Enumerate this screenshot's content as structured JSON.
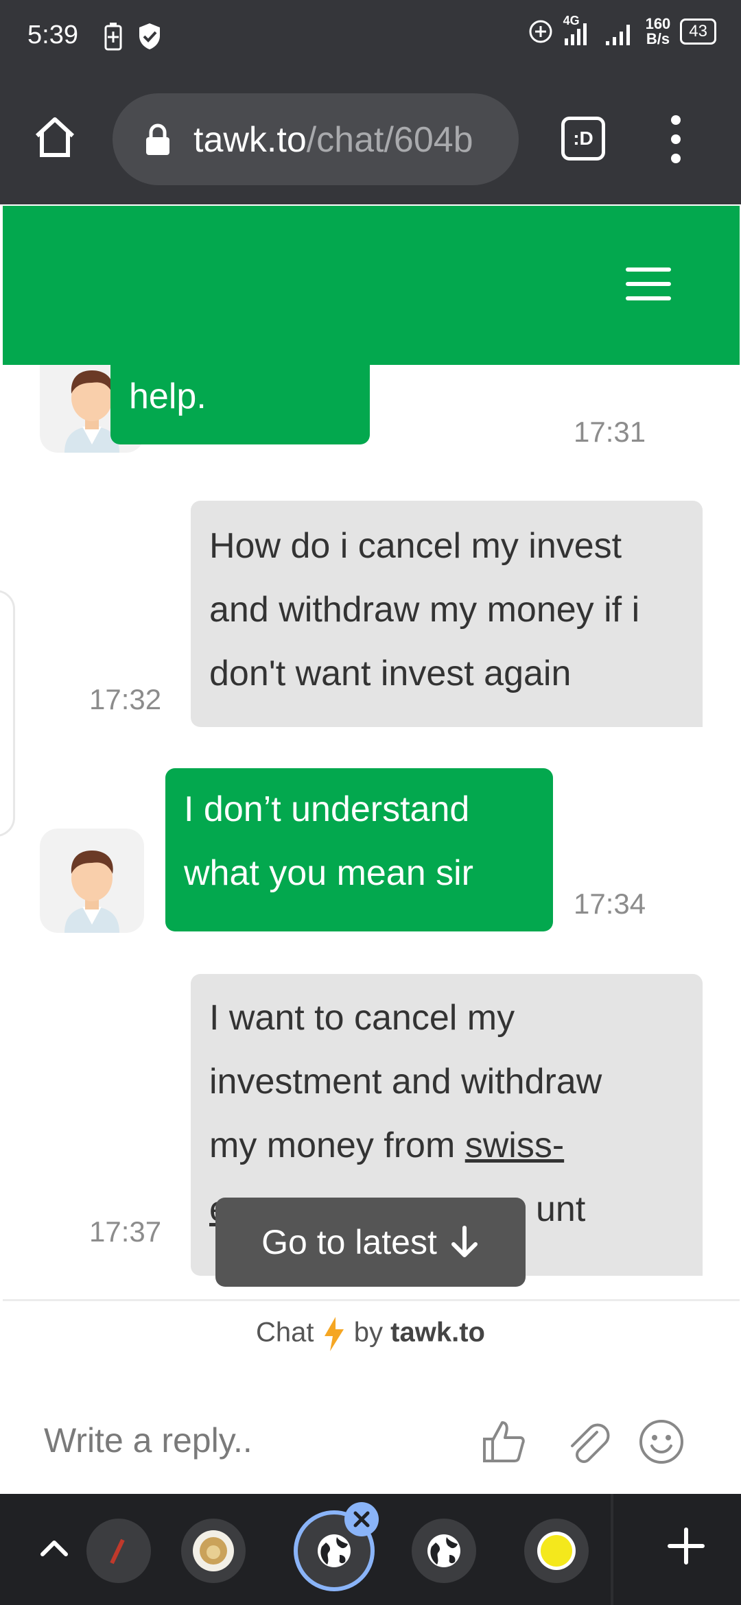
{
  "status_bar": {
    "time": "5:39",
    "network": "4G",
    "speed_value": "160",
    "speed_unit": "B/s",
    "battery": "43"
  },
  "browser": {
    "url_domain": "tawk.to",
    "url_path": "/chat/604b",
    "tabs_label": ":D"
  },
  "messages": [
    {
      "sender": "agent",
      "text": "help.",
      "time": "17:31"
    },
    {
      "sender": "visitor",
      "lines": [
        "How do i cancel my invest",
        "and withdraw my money if i",
        "don't want invest again"
      ],
      "time": "17:32"
    },
    {
      "sender": "agent",
      "lines": [
        "I don’t understand",
        "what you mean sir"
      ],
      "time": "17:34"
    },
    {
      "sender": "visitor",
      "lines": [
        "I want to cancel my",
        "investment and withdraw",
        "my money from "
      ],
      "link_text": "swiss-",
      "partial_line_start": "e",
      "partial_line_end": "unt",
      "time": "17:37"
    }
  ],
  "go_latest": "Go to latest",
  "footer": {
    "chat_label": "Chat",
    "by_label": "by",
    "brand": "tawk.to"
  },
  "reply": {
    "placeholder": "Write a reply.."
  },
  "colors": {
    "brand_green": "#03a84e",
    "visitor_bubble": "#e4e4e4",
    "chrome_dark": "#35363a"
  }
}
